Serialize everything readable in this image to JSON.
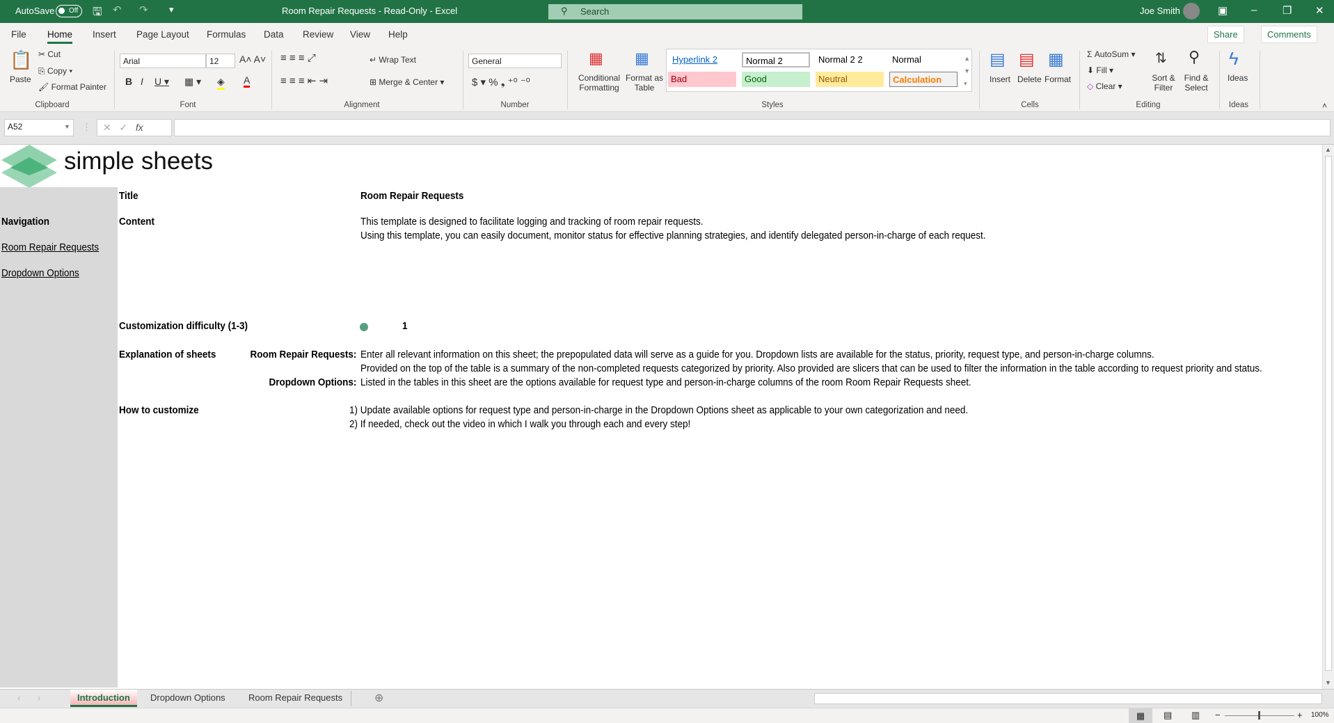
{
  "titlebar": {
    "autosave": "AutoSave",
    "autosave_state": "Off",
    "title": "Room Repair Requests  -  Read-Only  -  Excel",
    "search": "Search",
    "user": "Joe Smith"
  },
  "menu": {
    "tabs": [
      "File",
      "Home",
      "Insert",
      "Page Layout",
      "Formulas",
      "Data",
      "Review",
      "View",
      "Help"
    ],
    "share": "Share",
    "comments": "Comments"
  },
  "ribbon": {
    "clipboard": {
      "label": "Clipboard",
      "paste": "Paste",
      "cut": "Cut",
      "copy": "Copy",
      "format_painter": "Format Painter"
    },
    "font": {
      "label": "Font",
      "name": "Arial",
      "size": "12"
    },
    "alignment": {
      "label": "Alignment",
      "wrap": "Wrap Text",
      "merge": "Merge & Center"
    },
    "number": {
      "label": "Number",
      "format": "General"
    },
    "styles": {
      "label": "Styles",
      "conditional": "Conditional Formatting",
      "format_table": "Format as Table",
      "cells": [
        "Hyperlink 2",
        "Normal 2",
        "Normal 2 2",
        "Normal",
        "Bad",
        "Good",
        "Neutral",
        "Calculation"
      ]
    },
    "cells": {
      "label": "Cells",
      "insert": "Insert",
      "delete": "Delete",
      "format": "Format"
    },
    "editing": {
      "label": "Editing",
      "autosum": "AutoSum",
      "fill": "Fill",
      "clear": "Clear",
      "sort": "Sort & Filter",
      "find": "Find & Select"
    },
    "ideas": {
      "label": "Ideas",
      "ideas": "Ideas"
    }
  },
  "formula_bar": {
    "name_box": "A52",
    "value": ""
  },
  "logo": "simple sheets",
  "sheet": {
    "title_label": "Title",
    "title_value": "Room Repair Requests",
    "nav_label": "Navigation",
    "nav_links": [
      "Room Repair Requests",
      "Dropdown Options"
    ],
    "content_label": "Content",
    "content_lines": [
      "This template is designed to facilitate logging and tracking of room repair requests.",
      "Using this template, you can easily document, monitor status for effective planning strategies, and identify delegated person-in-charge of each request."
    ],
    "difficulty_label": "Customization difficulty (1-3)",
    "difficulty_value": "1",
    "difficulty_color": "#5a9e80",
    "explanation_label": "Explanation of sheets",
    "explanations": [
      {
        "sheet": "Room Repair Requests:",
        "lines": [
          "Enter all relevant information on this sheet; the prepopulated data will serve as a guide for you. Dropdown lists are available for the status, priority, request type, and person-in-charge columns.",
          "Provided on the top of the table is a summary of the non-completed requests categorized by priority. Also provided are slicers that can be used to filter the information in the table according to request priority and status."
        ]
      },
      {
        "sheet": "Dropdown Options:",
        "lines": [
          "Listed in the tables in this sheet are the options available for request type and person-in-charge columns of the room Room Repair Requests sheet."
        ]
      }
    ],
    "customize_label": "How to customize",
    "customize_steps": [
      "1) Update available options for request type and person-in-charge in the Dropdown Options sheet as applicable to your own categorization and need.",
      "2) If needed, check out the video in which I walk you through each and every step!"
    ]
  },
  "sheet_tabs": [
    "Introduction",
    "Dropdown Options",
    "Room Repair Requests"
  ],
  "status": {
    "zoom": "100%"
  }
}
